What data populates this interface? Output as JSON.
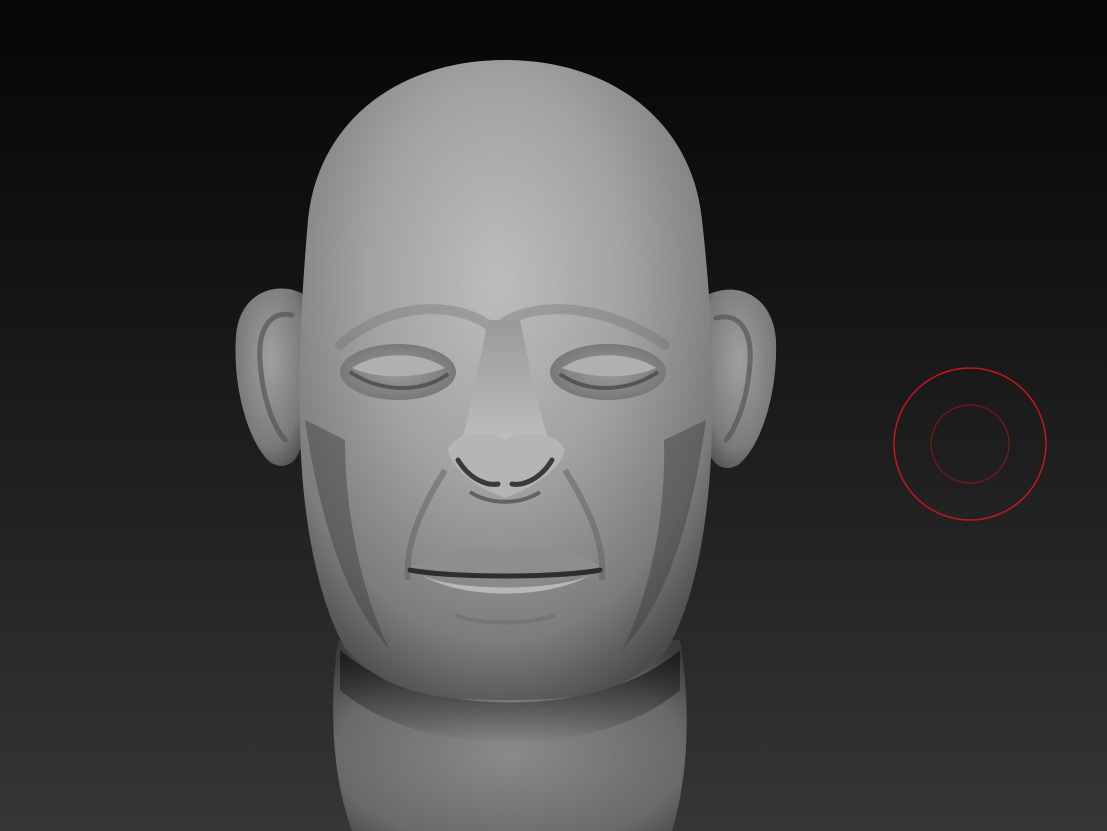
{
  "viewport": {
    "background_top": "#060606",
    "background_bottom": "#363636",
    "model": {
      "name": "sculpted-head",
      "material_base": "#8a8a8a",
      "material_highlight": "#c4c4c4",
      "material_shadow": "#2a2a2a"
    },
    "brush_cursor": {
      "icon": "brush-cursor-icon",
      "outer_color": "#c8141e",
      "inner_color": "#7a1a1a"
    }
  }
}
